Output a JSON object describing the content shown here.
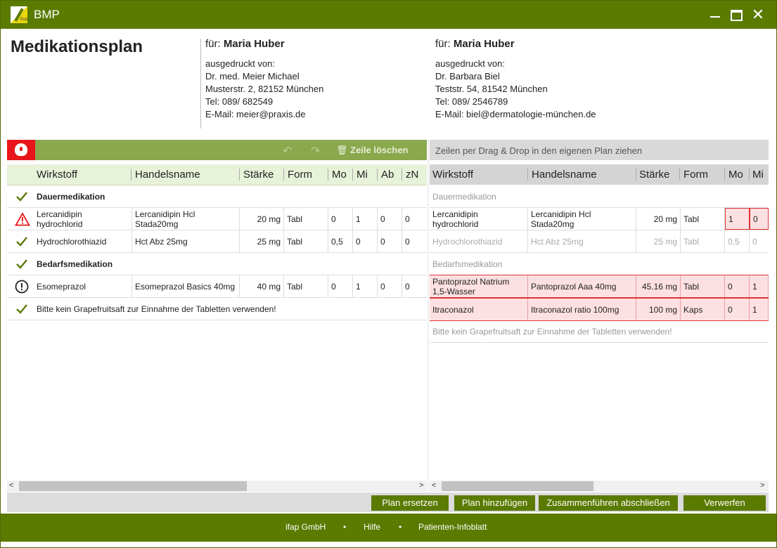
{
  "window": {
    "app_title": "BMP",
    "logo_text": "ifap"
  },
  "header": {
    "title": "Medikationsplan",
    "left": {
      "for_label": "für:",
      "patient": "Maria Huber",
      "printed_by": "ausgedruckt von:",
      "doctor": "Dr. med. Meier Michael",
      "address": "Musterstr. 2, 82152 München",
      "phone": "Tel: 089/ 682549",
      "email": "E-Mail: meier@praxis.de"
    },
    "right": {
      "for_label": "für:",
      "patient": "Maria Huber",
      "printed_by": "ausgedruckt von:",
      "doctor": "Dr. Barbara Biel",
      "address": "Teststr. 54, 81542 München",
      "phone": "Tel: 089/ 2546789",
      "email": "E-Mail: biel@dermatologie-münchen.de"
    }
  },
  "toolbar": {
    "delete_row": "Zeile löschen",
    "drag_hint": "Zeilen per Drag & Drop in den eigenen Plan ziehen"
  },
  "columns": {
    "wirkstoff": "Wirkstoff",
    "handelsname": "Handelsname",
    "staerke": "Stärke",
    "form": "Form",
    "mo": "Mo",
    "mi": "Mi",
    "ab": "Ab",
    "zn": "zN"
  },
  "left_plan": {
    "sections": {
      "dauer": "Dauermedikation",
      "bedarf": "Bedarfsmedikation"
    },
    "rows": [
      {
        "icon": "warning-triangle-icon",
        "wirkstoff": "Lercanidipin hydrochlorid",
        "handelsname": "Lercanidipin Hcl Stada20mg",
        "staerke": "20 mg",
        "form": "Tabl",
        "mo": "0",
        "mi": "1",
        "ab": "0",
        "zn": "0"
      },
      {
        "icon": "check-icon",
        "wirkstoff": "Hydrochlorothiazid",
        "handelsname": "Hct Abz 25mg",
        "staerke": "25 mg",
        "form": "Tabl",
        "mo": "0,5",
        "mi": "0",
        "ab": "0",
        "zn": "0"
      },
      {
        "icon": "exclamation-circle-icon",
        "wirkstoff": "Esomeprazol",
        "handelsname": "Esomeprazol Basics 40mg",
        "staerke": "40 mg",
        "form": "Tabl",
        "mo": "0",
        "mi": "1",
        "ab": "0",
        "zn": "0"
      }
    ],
    "note": "Bitte kein Grapefruitsaft zur Einnahme der Tabletten verwenden!"
  },
  "right_plan": {
    "sections": {
      "dauer": "Dauermedikation",
      "bedarf": "Bedarfsmedikation"
    },
    "rows": [
      {
        "wirkstoff": "Lercanidipin hydrochlorid",
        "handelsname": "Lercanidipin Hcl Stada20mg",
        "staerke": "20 mg",
        "form": "Tabl",
        "mo": "1",
        "mi": "0"
      },
      {
        "wirkstoff": "Hydrochlorothiazid",
        "handelsname": "Hct Abz 25mg",
        "staerke": "25 mg",
        "form": "Tabl",
        "mo": "0,5",
        "mi": "0"
      },
      {
        "wirkstoff": "Pantoprazol Natrium 1,5-Wasser",
        "handelsname": "Pantoprazol Aaa 40mg",
        "staerke": "45.16 mg",
        "form": "Tabl",
        "mo": "0",
        "mi": "1"
      },
      {
        "wirkstoff": "Itraconazol",
        "handelsname": "Itraconazol ratio 100mg",
        "staerke": "100 mg",
        "form": "Kaps",
        "mo": "0",
        "mi": "1"
      }
    ],
    "note": "Bitte kein Grapefruitsaft zur Einnahme der Tabletten verwenden!"
  },
  "buttons": {
    "replace": "Plan ersetzen",
    "add": "Plan hinzufügen",
    "merge": "Zusammenführen abschließen",
    "discard": "Verwerfen"
  },
  "footer": {
    "company": "ifap GmbH",
    "help": "Hilfe",
    "infoblatt": "Patienten-Infoblatt",
    "separator": "•"
  },
  "colors": {
    "brand": "#5a7a00",
    "toolbar": "#8aa84c",
    "alert": "#e8161a",
    "highlight": "#fde0e2"
  }
}
